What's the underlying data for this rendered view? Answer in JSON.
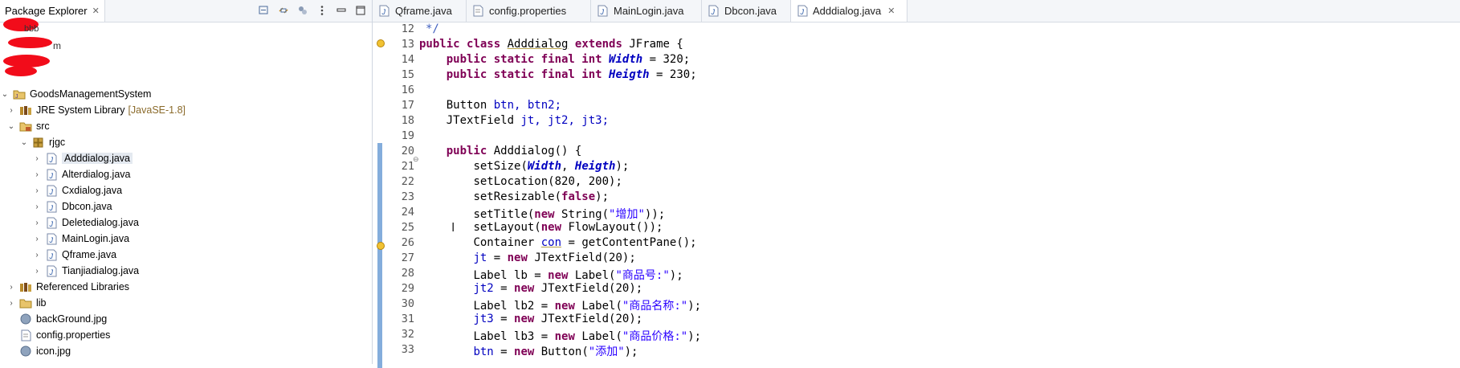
{
  "package_explorer": {
    "title": "Package Explorer",
    "project": "GoodsManagementSystem",
    "items": [
      {
        "label": "JRE System Library",
        "suffix": "[JavaSE-1.8]",
        "icon": "library-icon"
      },
      {
        "label": "src",
        "icon": "source-folder-icon"
      },
      {
        "label": "rjgc",
        "icon": "package-icon"
      },
      {
        "label": "Adddialog.java",
        "icon": "java-file-icon",
        "selected": true
      },
      {
        "label": "Alterdialog.java",
        "icon": "java-file-icon"
      },
      {
        "label": "Cxdialog.java",
        "icon": "java-file-icon"
      },
      {
        "label": "Dbcon.java",
        "icon": "java-file-icon"
      },
      {
        "label": "Deletedialog.java",
        "icon": "java-file-icon"
      },
      {
        "label": "MainLogin.java",
        "icon": "java-file-icon"
      },
      {
        "label": "Qframe.java",
        "icon": "java-file-icon"
      },
      {
        "label": "Tianjiadialog.java",
        "icon": "java-file-icon"
      },
      {
        "label": "Referenced Libraries",
        "icon": "library-icon"
      },
      {
        "label": "lib",
        "icon": "folder-icon"
      },
      {
        "label": "backGround.jpg",
        "icon": "image-file-icon"
      },
      {
        "label": "config.properties",
        "icon": "text-file-icon"
      },
      {
        "label": "icon.jpg",
        "icon": "image-file-icon"
      }
    ],
    "redacted_partial": {
      "top": "bbb",
      "mid": "m"
    }
  },
  "editor": {
    "tabs": [
      {
        "label": "Qframe.java",
        "icon": "java-file-icon"
      },
      {
        "label": "config.properties",
        "icon": "text-file-icon"
      },
      {
        "label": "MainLogin.java",
        "icon": "java-file-icon"
      },
      {
        "label": "Dbcon.java",
        "icon": "java-file-icon"
      },
      {
        "label": "Adddialog.java",
        "icon": "java-file-icon",
        "active": true
      }
    ],
    "line_numbers": [
      "12",
      "13",
      "14",
      "15",
      "16",
      "17",
      "18",
      "19",
      "20",
      "21",
      "22",
      "23",
      "24",
      "25",
      "26",
      "27",
      "28",
      "29",
      "30",
      "31",
      "32",
      "33"
    ],
    "code": {
      "l12": "*/",
      "l13_kw1": "public",
      "l13_kw2": "class",
      "l13_name": "Adddialog",
      "l13_kw3": "extends",
      "l13_rest": "JFrame {",
      "l14_kw": "public static final int",
      "l14_fld": "Width",
      "l14_rest": "= 320;",
      "l15_kw": "public static final int",
      "l15_fld": "Heigth",
      "l15_rest": "= 230;",
      "l17_type": "Button",
      "l17_vars": "btn, btn2;",
      "l18_type": "JTextField",
      "l18_vars": "jt, jt2, jt3;",
      "l20_kw": "public",
      "l20_rest": "Adddialog() {",
      "l21_a": "setSize(",
      "l21_f1": "Width",
      "l21_b": ", ",
      "l21_f2": "Heigth",
      "l21_c": ");",
      "l22": "setLocation(820, 200);",
      "l23_a": "setResizable(",
      "l23_kw": "false",
      "l23_b": ");",
      "l24_a": "setTitle(",
      "l24_kw": "new",
      "l24_b": " String(",
      "l24_str": "\"增加\"",
      "l24_c": "));",
      "l25_a": "setLayout(",
      "l25_kw": "new",
      "l25_b": " FlowLayout());",
      "l26_a": "Container ",
      "l26_var": "con",
      "l26_b": " = getContentPane();",
      "l27_var": "jt",
      "l27_a": " = ",
      "l27_kw": "new",
      "l27_b": " JTextField(20);",
      "l28_a": "Label lb = ",
      "l28_kw": "new",
      "l28_b": " Label(",
      "l28_str": "\"商品号:\"",
      "l28_c": ");",
      "l29_var": "jt2",
      "l29_a": " = ",
      "l29_kw": "new",
      "l29_b": " JTextField(20);",
      "l30_a": "Label lb2 = ",
      "l30_kw": "new",
      "l30_b": " Label(",
      "l30_str": "\"商品名称:\"",
      "l30_c": ");",
      "l31_var": "jt3",
      "l31_a": " = ",
      "l31_kw": "new",
      "l31_b": " JTextField(20);",
      "l32_a": "Label lb3 = ",
      "l32_kw": "new",
      "l32_b": " Label(",
      "l32_str": "\"商品价格:\"",
      "l32_c": ");",
      "l33_var": "btn",
      "l33_a": " = ",
      "l33_kw": "new",
      "l33_b": " Button(",
      "l33_str": "\"添加\"",
      "l33_c": ");"
    }
  },
  "colors": {
    "keyword": "#7f0055",
    "field": "#0000c0",
    "string": "#2a00ff",
    "selection": "#e4e9f0",
    "fold_bar": "#6f9fd6"
  }
}
